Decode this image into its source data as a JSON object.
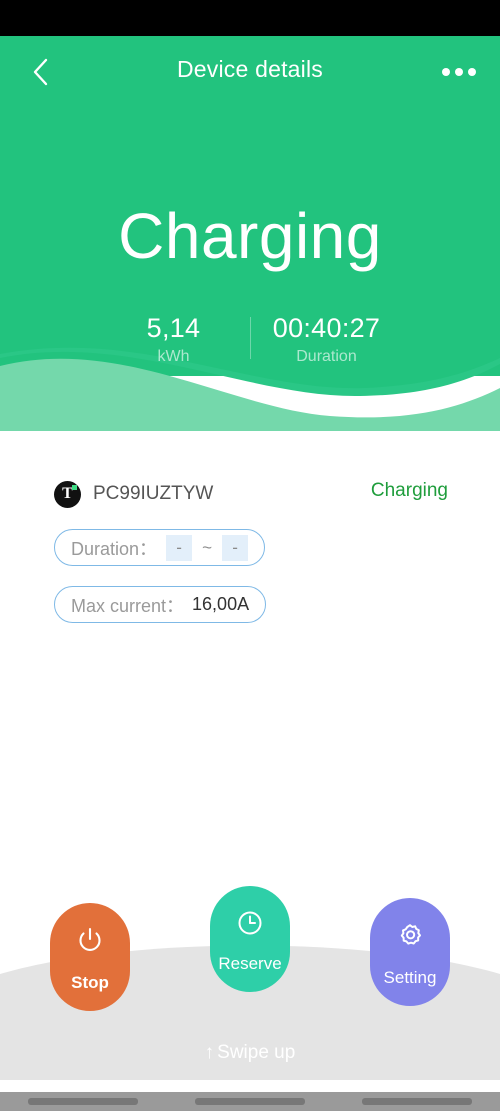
{
  "header": {
    "title": "Device details",
    "back_icon": "chevron-left-icon",
    "more_icon": "more-horizontal-icon"
  },
  "hero": {
    "status": "Charging",
    "metrics": [
      {
        "value": "5,14",
        "label": "kWh"
      },
      {
        "value": "00:40:27",
        "label": "Duration"
      }
    ]
  },
  "device": {
    "badge_glyph": "T",
    "badge_icon": "tuya-device-icon",
    "id": "PC99IUZTYW",
    "state": "Charging",
    "state_color": "#1f9d3c"
  },
  "fields": {
    "duration": {
      "label": "Duration：",
      "from": "-",
      "separator": "~",
      "to": "-"
    },
    "max_current": {
      "label": "Max current：",
      "value": "16,00A"
    }
  },
  "actions": [
    {
      "label": "Stop",
      "icon": "power-icon",
      "color": "#e2703a"
    },
    {
      "label": "Reserve",
      "icon": "clock-icon",
      "color": "#2ecfa8"
    },
    {
      "label": "Setting",
      "icon": "gear-icon",
      "color": "#8183ea"
    }
  ],
  "sheet": {
    "swipe_arrow": "↑",
    "swipe_label": "Swipe up"
  },
  "colors": {
    "hero_green": "#22c37e",
    "wave_light": "#74d8ab",
    "sheet_grey": "#e4e4e4",
    "pill_border": "#7fb9e6",
    "range_box": "#e3effa"
  }
}
